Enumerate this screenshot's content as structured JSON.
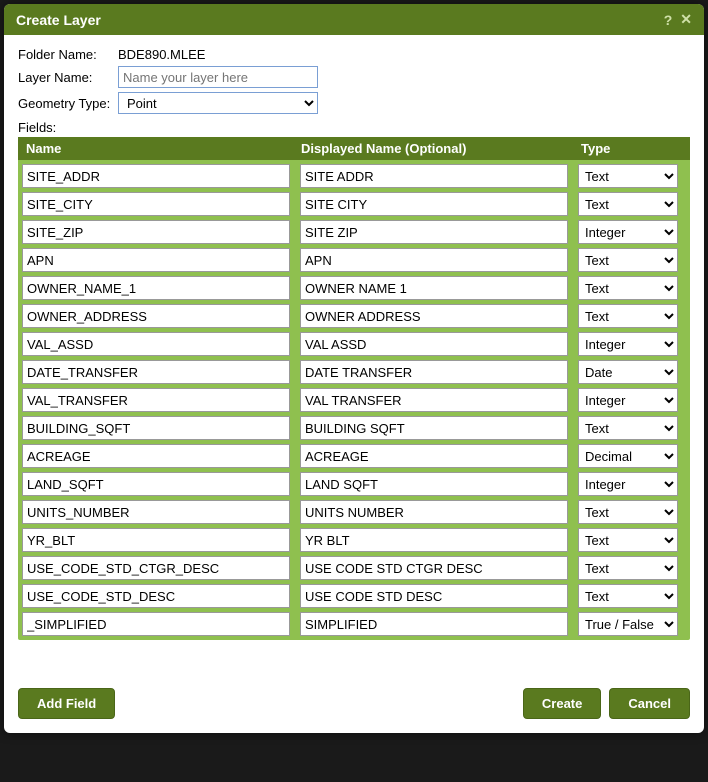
{
  "titlebar": {
    "title": "Create Layer"
  },
  "form": {
    "folder_name_label": "Folder Name:",
    "folder_name_value": "BDE890.MLEE",
    "layer_name_label": "Layer Name:",
    "layer_name_placeholder": "Name your layer here",
    "layer_name_value": "",
    "geometry_type_label": "Geometry Type:",
    "geometry_type_value": "Point"
  },
  "fields_label": "Fields:",
  "headers": {
    "name": "Name",
    "displayed": "Displayed Name (Optional)",
    "type": "Type"
  },
  "type_options": [
    "Text",
    "Integer",
    "Decimal",
    "Date",
    "True / False"
  ],
  "fields": [
    {
      "name": "SITE_ADDR",
      "displayed": "SITE ADDR",
      "type": "Text"
    },
    {
      "name": "SITE_CITY",
      "displayed": "SITE CITY",
      "type": "Text"
    },
    {
      "name": "SITE_ZIP",
      "displayed": "SITE ZIP",
      "type": "Integer"
    },
    {
      "name": "APN",
      "displayed": "APN",
      "type": "Text"
    },
    {
      "name": "OWNER_NAME_1",
      "displayed": "OWNER NAME 1",
      "type": "Text"
    },
    {
      "name": "OWNER_ADDRESS",
      "displayed": "OWNER ADDRESS",
      "type": "Text"
    },
    {
      "name": "VAL_ASSD",
      "displayed": "VAL ASSD",
      "type": "Integer"
    },
    {
      "name": "DATE_TRANSFER",
      "displayed": "DATE TRANSFER",
      "type": "Date"
    },
    {
      "name": "VAL_TRANSFER",
      "displayed": "VAL TRANSFER",
      "type": "Integer"
    },
    {
      "name": "BUILDING_SQFT",
      "displayed": "BUILDING SQFT",
      "type": "Text"
    },
    {
      "name": "ACREAGE",
      "displayed": "ACREAGE",
      "type": "Decimal"
    },
    {
      "name": "LAND_SQFT",
      "displayed": "LAND SQFT",
      "type": "Integer"
    },
    {
      "name": "UNITS_NUMBER",
      "displayed": "UNITS NUMBER",
      "type": "Text"
    },
    {
      "name": "YR_BLT",
      "displayed": "YR BLT",
      "type": "Text"
    },
    {
      "name": "USE_CODE_STD_CTGR_DESC",
      "displayed": "USE CODE STD CTGR DESC",
      "type": "Text"
    },
    {
      "name": "USE_CODE_STD_DESC",
      "displayed": "USE CODE STD DESC",
      "type": "Text"
    },
    {
      "name": "_SIMPLIFIED",
      "displayed": "SIMPLIFIED",
      "type": "True / False"
    }
  ],
  "buttons": {
    "add_field": "Add Field",
    "create": "Create",
    "cancel": "Cancel"
  }
}
